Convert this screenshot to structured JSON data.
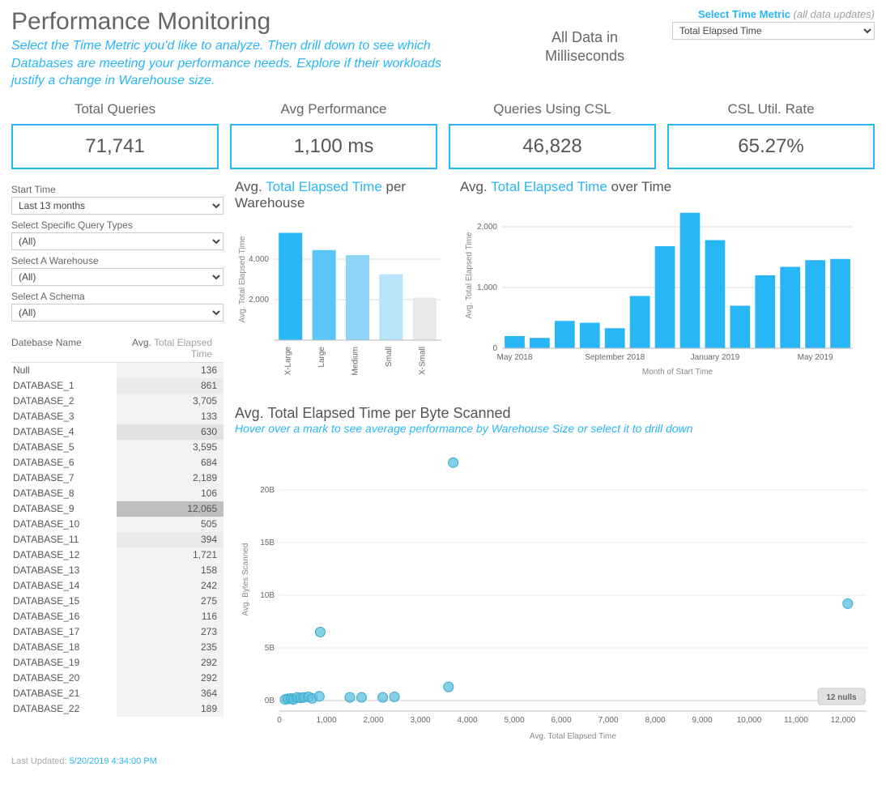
{
  "header": {
    "title": "Performance Monitoring",
    "subtitle": "Select the Time Metric you'd like to analyze. Then drill down to see which Databases are meeting your performance needs. Explore if their workloads justify a change in Warehouse size.",
    "units_line1": "All Data in",
    "units_line2": "Milliseconds",
    "metric_label_accent": "Select Time Metric",
    "metric_label_hint": "(all data updates)",
    "metric_value": "Total Elapsed Time"
  },
  "kpis": [
    {
      "title": "Total Queries",
      "value": "71,741"
    },
    {
      "title": "Avg Performance",
      "value": "1,100 ms"
    },
    {
      "title": "Queries Using CSL",
      "value": "46,828"
    },
    {
      "title": "CSL Util. Rate",
      "value": "65.27%"
    }
  ],
  "filters": {
    "start_time": {
      "label": "Start Time",
      "value": "Last 13 months"
    },
    "query_types": {
      "label": "Select Specific Query Types",
      "value": "(All)"
    },
    "warehouse": {
      "label": "Select A Warehouse",
      "value": "(All)"
    },
    "schema": {
      "label": "Select A Schema",
      "value": "(All)"
    }
  },
  "table": {
    "h1": "Datebase Name",
    "h2_pre": "Avg. ",
    "h2_metric": "Total Elapsed Time",
    "rows": [
      {
        "name": "Null",
        "val": "136"
      },
      {
        "name": "DATABASE_1",
        "val": "861"
      },
      {
        "name": "DATABASE_2",
        "val": "3,705"
      },
      {
        "name": "DATABASE_3",
        "val": "133"
      },
      {
        "name": "DATABASE_4",
        "val": "630"
      },
      {
        "name": "DATABASE_5",
        "val": "3,595"
      },
      {
        "name": "DATABASE_6",
        "val": "684"
      },
      {
        "name": "DATABASE_7",
        "val": "2,189"
      },
      {
        "name": "DATABASE_8",
        "val": "106"
      },
      {
        "name": "DATABASE_9",
        "val": "12,065"
      },
      {
        "name": "DATABASE_10",
        "val": "505"
      },
      {
        "name": "DATABASE_11",
        "val": "394"
      },
      {
        "name": "DATABASE_12",
        "val": "1,721"
      },
      {
        "name": "DATABASE_13",
        "val": "158"
      },
      {
        "name": "DATABASE_14",
        "val": "242"
      },
      {
        "name": "DATABASE_15",
        "val": "275"
      },
      {
        "name": "DATABASE_16",
        "val": "116"
      },
      {
        "name": "DATABASE_17",
        "val": "273"
      },
      {
        "name": "DATABASE_18",
        "val": "235"
      },
      {
        "name": "DATABASE_19",
        "val": "292"
      },
      {
        "name": "DATABASE_20",
        "val": "292"
      },
      {
        "name": "DATABASE_21",
        "val": "364"
      },
      {
        "name": "DATABASE_22",
        "val": "189"
      }
    ]
  },
  "chart_data": [
    {
      "id": "warehouse_bar",
      "type": "bar",
      "title_pre": "Avg. ",
      "title_metric": "Total Elapsed Time",
      "title_post": " per Warehouse",
      "ylabel": "Avg. Total Elapsed Time",
      "ylim": [
        0,
        6000
      ],
      "yticks": [
        2000,
        4000
      ],
      "categories": [
        "X-Large",
        "Large",
        "Medium",
        "Small",
        "X-Small"
      ],
      "values": [
        5300,
        4450,
        4200,
        3250,
        2100
      ],
      "colors": [
        "#29b6f6",
        "#5bc6f7",
        "#8ed6f9",
        "#b7e4fb",
        "#e8e8e8"
      ]
    },
    {
      "id": "time_bar",
      "type": "bar",
      "title_pre": "Avg. ",
      "title_metric": "Total Elapsed Time",
      "title_post": " over Time",
      "ylabel": "Avg. Total Elapsed Time",
      "xlabel": "Month of Start Time",
      "ylim": [
        0,
        2400
      ],
      "yticks": [
        0,
        1000,
        2000
      ],
      "categories": [
        "May 2018",
        "Jun 2018",
        "Jul 2018",
        "Aug 2018",
        "Sep 2018",
        "Oct 2018",
        "Nov 2018",
        "Dec 2018",
        "Jan 2019",
        "Feb 2019",
        "Mar 2019",
        "Apr 2019",
        "May 2019",
        "Jun 2019"
      ],
      "values": [
        200,
        170,
        450,
        420,
        330,
        860,
        1680,
        2230,
        1780,
        700,
        1200,
        1340,
        1450,
        1470
      ],
      "xtick_labels": [
        "May 2018",
        "September 2018",
        "January 2019",
        "May 2019"
      ],
      "xtick_idx": [
        0,
        4,
        8,
        12
      ],
      "color": "#29b6f6"
    },
    {
      "id": "scatter",
      "type": "scatter",
      "title": "Avg. Total Elapsed Time per Byte Scanned",
      "subtitle": "Hover over a mark to see average performance by Warehouse Size or select it to drill down",
      "xlabel": "Avg. Total Elapsed Time",
      "ylabel": "Avg. Bytes Scanned",
      "xlim": [
        0,
        12500
      ],
      "ylim": [
        -1,
        24
      ],
      "xticks": [
        0,
        1000,
        2000,
        3000,
        4000,
        5000,
        6000,
        7000,
        8000,
        9000,
        10000,
        11000,
        12000
      ],
      "yticks": [
        0,
        5,
        10,
        15,
        20
      ],
      "ytick_labels": [
        "0B",
        "5B",
        "10B",
        "15B",
        "20B"
      ],
      "points": [
        {
          "x": 120,
          "y": 0.1
        },
        {
          "x": 180,
          "y": 0.15
        },
        {
          "x": 250,
          "y": 0.2
        },
        {
          "x": 300,
          "y": 0.1
        },
        {
          "x": 380,
          "y": 0.3
        },
        {
          "x": 450,
          "y": 0.25
        },
        {
          "x": 520,
          "y": 0.3
        },
        {
          "x": 620,
          "y": 0.35
        },
        {
          "x": 700,
          "y": 0.2
        },
        {
          "x": 850,
          "y": 0.4
        },
        {
          "x": 870,
          "y": 6.5
        },
        {
          "x": 1500,
          "y": 0.3
        },
        {
          "x": 1750,
          "y": 0.3
        },
        {
          "x": 2200,
          "y": 0.3
        },
        {
          "x": 2450,
          "y": 0.35
        },
        {
          "x": 3600,
          "y": 1.3
        },
        {
          "x": 3700,
          "y": 22.6
        },
        {
          "x": 12100,
          "y": 9.2
        }
      ],
      "nulls_label": "12 nulls"
    }
  ],
  "footer": {
    "label": "Last Updated: ",
    "ts": "5/20/2019 4:34:00 PM"
  }
}
